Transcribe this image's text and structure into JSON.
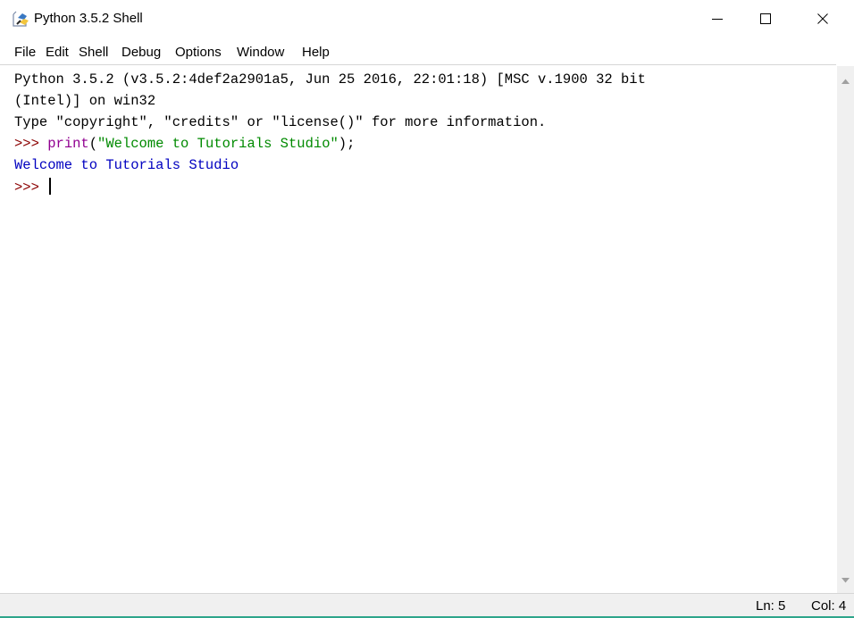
{
  "window": {
    "title": "Python 3.5.2 Shell",
    "icon": "python-idle-icon"
  },
  "title_buttons": {
    "minimize": "minimize-icon",
    "maximize": "maximize-icon",
    "close": "close-icon"
  },
  "menu": {
    "items": [
      {
        "label": "File"
      },
      {
        "label": "Edit"
      },
      {
        "label": "Shell"
      },
      {
        "label": "Debug"
      },
      {
        "label": "Options"
      },
      {
        "label": "Window"
      },
      {
        "label": "Help"
      }
    ]
  },
  "shell": {
    "banner_line1": "Python 3.5.2 (v3.5.2:4def2a2901a5, Jun 25 2016, 22:01:18) [MSC v.1900 32 bit",
    "banner_line2": "(Intel)] on win32",
    "banner_line3": "Type \"copyright\", \"credits\" or \"license()\" for more information.",
    "prompt": ">>> ",
    "command_builtin": "print",
    "command_open": "(",
    "command_string": "\"Welcome to Tutorials Studio\"",
    "command_close": ");",
    "output": "Welcome to Tutorials Studio",
    "prompt2": ">>> "
  },
  "status": {
    "line": "Ln: 5",
    "col": "Col: 4"
  },
  "colors": {
    "prompt": "#8b0000",
    "builtin": "#900090",
    "string": "#008a00",
    "output": "#0000c0",
    "accent": "#2ea58a"
  }
}
